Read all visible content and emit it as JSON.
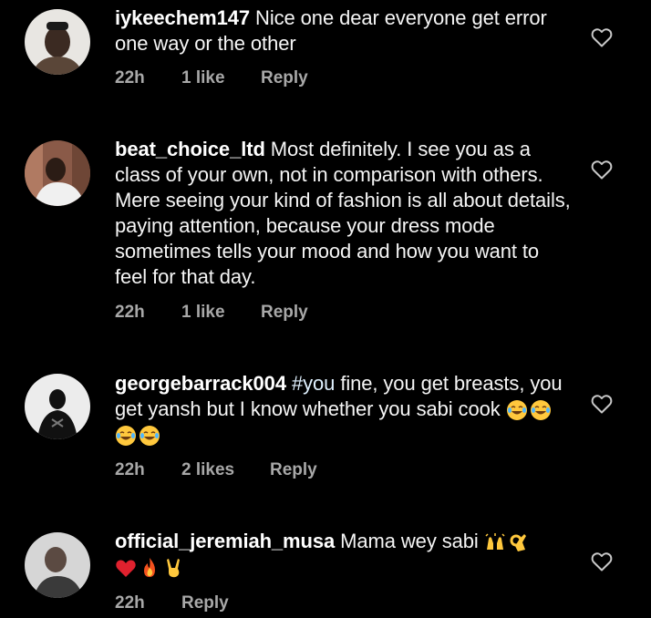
{
  "comments": [
    {
      "username": "iykeechem147",
      "text": "Nice one dear everyone get error one way or the other",
      "time": "22h",
      "likes": "1 like",
      "reply": "Reply"
    },
    {
      "username": "beat_choice_ltd",
      "text": "Most definitely. I see you as a class of your own, not in comparison with others. Mere seeing your kind of fashion is all about details, paying attention, because your dress mode sometimes tells your mood and how you want to feel for that day.",
      "time": "22h",
      "likes": "1 like",
      "reply": "Reply"
    },
    {
      "username": "georgebarrack004",
      "hashtag": "#you",
      "text": "fine, you get breasts, you get yansh but I know whether you sabi cook",
      "emojis": [
        "joy-emoji",
        "joy-emoji",
        "joy-emoji",
        "joy-emoji"
      ],
      "time": "22h",
      "likes": "2 likes",
      "reply": "Reply"
    },
    {
      "username": "official_jeremiah_musa",
      "text": "Mama wey sabi",
      "emojis": [
        "raising-hands-emoji",
        "ok-hand-emoji",
        "red-heart-emoji",
        "fire-emoji",
        "victory-hand-emoji"
      ],
      "time": "22h",
      "reply": "Reply"
    }
  ],
  "colors": {
    "background": "#000000",
    "text": "#f5f5f5",
    "meta": "#a8a8a8",
    "heart_outline": "#c8c8c8",
    "emoji_yellow": "#ffc83d",
    "emoji_red": "#e0212e"
  }
}
